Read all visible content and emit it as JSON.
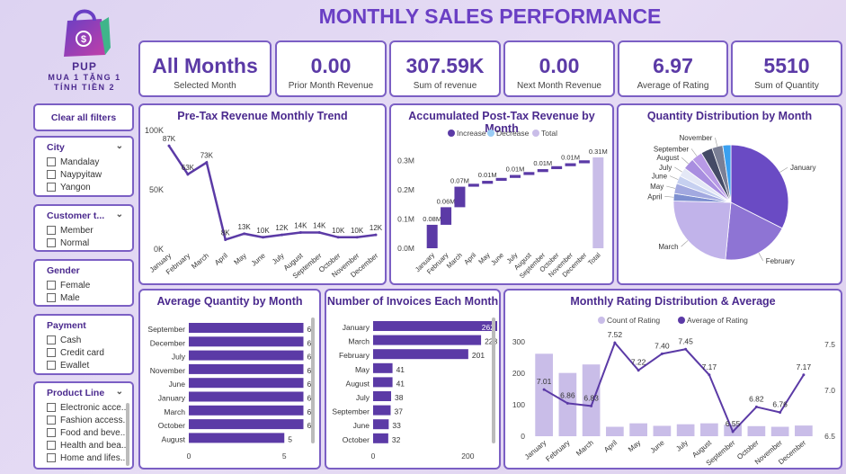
{
  "title": "MONTHLY SALES PERFORMANCE",
  "logo": {
    "line1": "PUP",
    "line2": "MUA 1 TẶNG 1",
    "line3": "TÍNH TIỀN 2"
  },
  "kpis": [
    {
      "value": "All Months",
      "label": "Selected Month"
    },
    {
      "value": "0.00",
      "label": "Prior Month Revenue"
    },
    {
      "value": "307.59K",
      "label": "Sum of revenue"
    },
    {
      "value": "0.00",
      "label": "Next Month Revenue"
    },
    {
      "value": "6.97",
      "label": "Average of Rating"
    },
    {
      "value": "5510",
      "label": "Sum of Quantity"
    }
  ],
  "clear_filters": "Clear all filters",
  "filters": {
    "city": {
      "label": "City",
      "options": [
        "Mandalay",
        "Naypyitaw",
        "Yangon"
      ]
    },
    "customer": {
      "label": "Customer t...",
      "options": [
        "Member",
        "Normal"
      ]
    },
    "gender": {
      "label": "Gender",
      "options": [
        "Female",
        "Male"
      ]
    },
    "payment": {
      "label": "Payment",
      "options": [
        "Cash",
        "Credit card",
        "Ewallet"
      ]
    },
    "product": {
      "label": "Product Line",
      "options": [
        "Electronic acce...",
        "Fashion access...",
        "Food and beve...",
        "Health and bea...",
        "Home and lifes..."
      ]
    }
  },
  "colors": {
    "accent": "#7b5fc4",
    "title": "#6a3fc4",
    "dark": "#5b3aa6",
    "light": "#c9bde8",
    "lightblue": "#99ccf5"
  },
  "chart_data": [
    {
      "type": "line",
      "title": "Pre-Tax Revenue Monthly Trend",
      "categories": [
        "January",
        "February",
        "March",
        "April",
        "May",
        "June",
        "July",
        "August",
        "September",
        "October",
        "November",
        "December"
      ],
      "values": [
        87,
        63,
        73,
        8,
        13,
        10,
        12,
        14,
        14,
        10,
        10,
        12
      ],
      "labels": [
        "87K",
        "63K",
        "73K",
        "8K",
        "13K",
        "10K",
        "12K",
        "14K",
        "14K",
        "10K",
        "10K",
        "12K"
      ],
      "yticks": [
        "0K",
        "50K",
        "100K"
      ],
      "ylim": [
        0,
        100
      ]
    },
    {
      "type": "bar",
      "title": "Accumulated Post-Tax Revenue by Month",
      "legend": [
        "Increase",
        "Decrease",
        "Total"
      ],
      "categories": [
        "January",
        "February",
        "March",
        "April",
        "May",
        "June",
        "July",
        "August",
        "September",
        "October",
        "November",
        "December",
        "Total"
      ],
      "values": [
        0.08,
        0.06,
        0.07,
        0.01,
        0.01,
        0.01,
        0.01,
        0.01,
        0.01,
        0.01,
        0.01,
        0.01,
        0.31
      ],
      "labels": [
        "0.08M",
        "0.06M",
        "0.07M",
        "",
        "0.01M",
        "",
        "0.01M",
        "",
        "0.01M",
        "",
        "0.01M",
        "",
        "0.31M"
      ],
      "yticks": [
        "0.0M",
        "0.1M",
        "0.2M",
        "0.3M"
      ],
      "ylim": [
        0,
        0.31
      ]
    },
    {
      "type": "pie",
      "title": "Quantity Distribution by Month",
      "categories": [
        "January",
        "February",
        "March",
        "April",
        "May",
        "June",
        "July",
        "August",
        "September",
        "October",
        "November",
        "December"
      ],
      "values": [
        1700,
        1000,
        1250,
        110,
        150,
        120,
        130,
        170,
        160,
        170,
        160,
        120
      ],
      "shown_labels": [
        "January",
        "February",
        "March",
        "April",
        "May",
        "June",
        "July",
        "August",
        "September",
        "November"
      ]
    },
    {
      "type": "bar",
      "title": "Average Quantity by Month",
      "categories": [
        "September",
        "December",
        "July",
        "November",
        "June",
        "January",
        "March",
        "October",
        "August"
      ],
      "values": [
        6,
        6,
        6,
        6,
        6,
        6,
        6,
        6,
        5
      ],
      "xticks": [
        "0",
        "5"
      ],
      "xlim": [
        0,
        6.4
      ]
    },
    {
      "type": "bar",
      "title": "Number of Invoices Each Month",
      "categories": [
        "January",
        "March",
        "February",
        "May",
        "August",
        "July",
        "September",
        "June",
        "October"
      ],
      "values": [
        262,
        228,
        201,
        41,
        41,
        38,
        37,
        33,
        32
      ],
      "xticks": [
        "0",
        "200"
      ],
      "xlim": [
        0,
        300
      ]
    },
    {
      "type": "bar",
      "title": "Monthly Rating Distribution & Average",
      "legend": [
        "Count of Rating",
        "Average of Rating"
      ],
      "categories": [
        "January",
        "February",
        "March",
        "April",
        "May",
        "June",
        "July",
        "August",
        "September",
        "October",
        "November",
        "December"
      ],
      "series": [
        {
          "name": "Count of Rating",
          "values": [
            262,
            201,
            228,
            30,
            41,
            33,
            38,
            41,
            37,
            32,
            30,
            34
          ]
        },
        {
          "name": "Average of Rating",
          "values": [
            7.01,
            6.86,
            6.83,
            7.52,
            7.22,
            7.4,
            7.45,
            7.17,
            6.55,
            6.82,
            6.76,
            7.17
          ]
        }
      ],
      "yticks": [
        "0",
        "100",
        "200",
        "300"
      ],
      "y2ticks": [
        "6.5",
        "7.0",
        "7.5"
      ],
      "ylim": [
        0,
        320
      ],
      "y2lim": [
        6.5,
        7.6
      ]
    }
  ]
}
